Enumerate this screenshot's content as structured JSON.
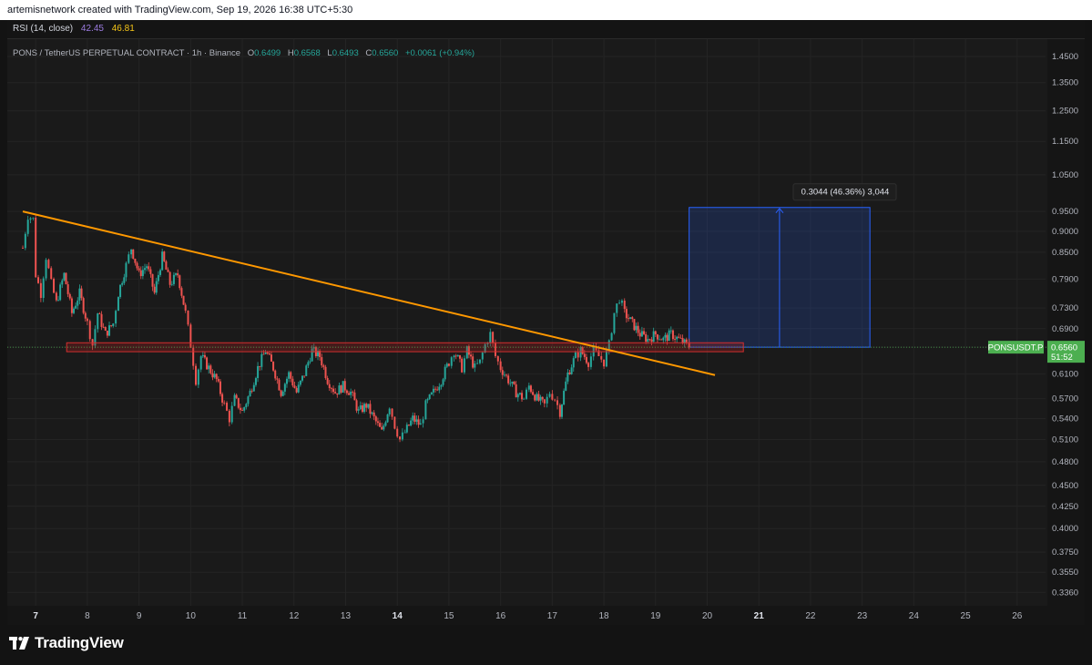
{
  "header": {
    "credit": "artemisnetwork created with TradingView.com, Sep 19, 2026 16:38 UTC+5:30"
  },
  "indicator": {
    "label": "RSI (14, close)",
    "value1": "42.45",
    "value2": "46.81"
  },
  "symbol_legend": {
    "title": "PONS / TetherUS PERPETUAL CONTRACT · 1h · Binance",
    "o_label": "O",
    "o": "0.6499",
    "h_label": "H",
    "h": "0.6568",
    "l_label": "L",
    "l": "0.6493",
    "c_label": "C",
    "c": "0.6560",
    "change": "+0.0061 (+0.94%)"
  },
  "price_tag": {
    "symbol": "PONSUSDT.P",
    "price": "0.6560",
    "countdown": "51:52"
  },
  "measure_label": "0.3044 (46.36%) 3,044",
  "brand": {
    "name": "TradingView",
    "icon": "tradingview-logo-icon"
  },
  "colors": {
    "background": "#131313",
    "panel": "#1a1a1a",
    "up": "#26a69a",
    "down": "#ef5350",
    "trendline": "#ff9800",
    "zone": "#b22222",
    "target_box": "#2962ff",
    "price_tag": "#4caf50"
  },
  "chart_data": {
    "type": "candlestick",
    "title": "PONS / TetherUS PERPETUAL CONTRACT · 1h · Binance",
    "scale": "log",
    "y_ticks": [
      "1.4500",
      "1.3500",
      "1.2500",
      "1.1500",
      "1.0500",
      "0.9500",
      "0.9000",
      "0.8500",
      "0.7900",
      "0.7300",
      "0.6900",
      "0.6560",
      "0.6100",
      "0.5700",
      "0.5400",
      "0.5100",
      "0.4800",
      "0.4500",
      "0.4250",
      "0.4000",
      "0.3750",
      "0.3550",
      "0.3360"
    ],
    "x_ticks": [
      "7",
      "8",
      "9",
      "10",
      "11",
      "12",
      "13",
      "14",
      "15",
      "16",
      "17",
      "18",
      "19",
      "20",
      "21",
      "22",
      "23",
      "24",
      "25",
      "26"
    ],
    "x_range_days": [
      6.45,
      26.55
    ],
    "y_range": [
      0.324,
      1.52
    ],
    "price_path": [
      [
        6.75,
        0.86
      ],
      [
        6.85,
        0.94
      ],
      [
        6.95,
        0.93
      ],
      [
        7.0,
        0.8
      ],
      [
        7.1,
        0.76
      ],
      [
        7.2,
        0.84
      ],
      [
        7.3,
        0.78
      ],
      [
        7.4,
        0.74
      ],
      [
        7.55,
        0.8
      ],
      [
        7.7,
        0.72
      ],
      [
        7.85,
        0.76
      ],
      [
        8.0,
        0.7
      ],
      [
        8.1,
        0.66
      ],
      [
        8.2,
        0.72
      ],
      [
        8.35,
        0.68
      ],
      [
        8.5,
        0.7
      ],
      [
        8.6,
        0.76
      ],
      [
        8.75,
        0.82
      ],
      [
        8.85,
        0.86
      ],
      [
        9.0,
        0.8
      ],
      [
        9.15,
        0.82
      ],
      [
        9.3,
        0.76
      ],
      [
        9.45,
        0.84
      ],
      [
        9.6,
        0.78
      ],
      [
        9.75,
        0.8
      ],
      [
        9.9,
        0.72
      ],
      [
        10.0,
        0.66
      ],
      [
        10.1,
        0.6
      ],
      [
        10.2,
        0.64
      ],
      [
        10.35,
        0.62
      ],
      [
        10.5,
        0.6
      ],
      [
        10.65,
        0.56
      ],
      [
        10.75,
        0.54
      ],
      [
        10.85,
        0.57
      ],
      [
        11.0,
        0.55
      ],
      [
        11.15,
        0.58
      ],
      [
        11.3,
        0.62
      ],
      [
        11.45,
        0.65
      ],
      [
        11.6,
        0.62
      ],
      [
        11.75,
        0.58
      ],
      [
        11.9,
        0.61
      ],
      [
        12.05,
        0.58
      ],
      [
        12.2,
        0.61
      ],
      [
        12.35,
        0.65
      ],
      [
        12.5,
        0.64
      ],
      [
        12.65,
        0.6
      ],
      [
        12.8,
        0.58
      ],
      [
        12.95,
        0.59
      ],
      [
        13.1,
        0.58
      ],
      [
        13.25,
        0.55
      ],
      [
        13.4,
        0.56
      ],
      [
        13.55,
        0.54
      ],
      [
        13.7,
        0.52
      ],
      [
        13.85,
        0.56
      ],
      [
        13.95,
        0.53
      ],
      [
        14.05,
        0.51
      ],
      [
        14.15,
        0.52
      ],
      [
        14.3,
        0.54
      ],
      [
        14.45,
        0.53
      ],
      [
        14.55,
        0.56
      ],
      [
        14.7,
        0.58
      ],
      [
        14.85,
        0.6
      ],
      [
        15.0,
        0.63
      ],
      [
        15.1,
        0.65
      ],
      [
        15.25,
        0.62
      ],
      [
        15.35,
        0.65
      ],
      [
        15.5,
        0.62
      ],
      [
        15.6,
        0.63
      ],
      [
        15.7,
        0.66
      ],
      [
        15.8,
        0.68
      ],
      [
        15.9,
        0.64
      ],
      [
        16.0,
        0.62
      ],
      [
        16.15,
        0.6
      ],
      [
        16.3,
        0.58
      ],
      [
        16.45,
        0.57
      ],
      [
        16.55,
        0.59
      ],
      [
        16.7,
        0.57
      ],
      [
        16.85,
        0.56
      ],
      [
        16.95,
        0.58
      ],
      [
        17.05,
        0.57
      ],
      [
        17.15,
        0.55
      ],
      [
        17.3,
        0.61
      ],
      [
        17.45,
        0.64
      ],
      [
        17.55,
        0.65
      ],
      [
        17.7,
        0.63
      ],
      [
        17.8,
        0.65
      ],
      [
        17.9,
        0.64
      ],
      [
        18.0,
        0.63
      ],
      [
        18.1,
        0.66
      ],
      [
        18.2,
        0.72
      ],
      [
        18.3,
        0.75
      ],
      [
        18.4,
        0.72
      ],
      [
        18.55,
        0.7
      ],
      [
        18.7,
        0.68
      ],
      [
        18.85,
        0.67
      ],
      [
        19.0,
        0.68
      ],
      [
        19.15,
        0.67
      ],
      [
        19.3,
        0.68
      ],
      [
        19.45,
        0.67
      ],
      [
        19.6,
        0.66
      ],
      [
        19.65,
        0.656
      ]
    ],
    "trendline": {
      "from": [
        6.75,
        0.95
      ],
      "to": [
        20.15,
        0.608
      ]
    },
    "support_zone": {
      "x": [
        7.6,
        20.7
      ],
      "y": [
        0.648,
        0.664
      ]
    },
    "target_box": {
      "x": [
        19.65,
        23.15
      ],
      "y": [
        0.656,
        0.9604
      ],
      "label": "0.3044 (46.36%) 3,044"
    },
    "last_price": 0.656
  }
}
